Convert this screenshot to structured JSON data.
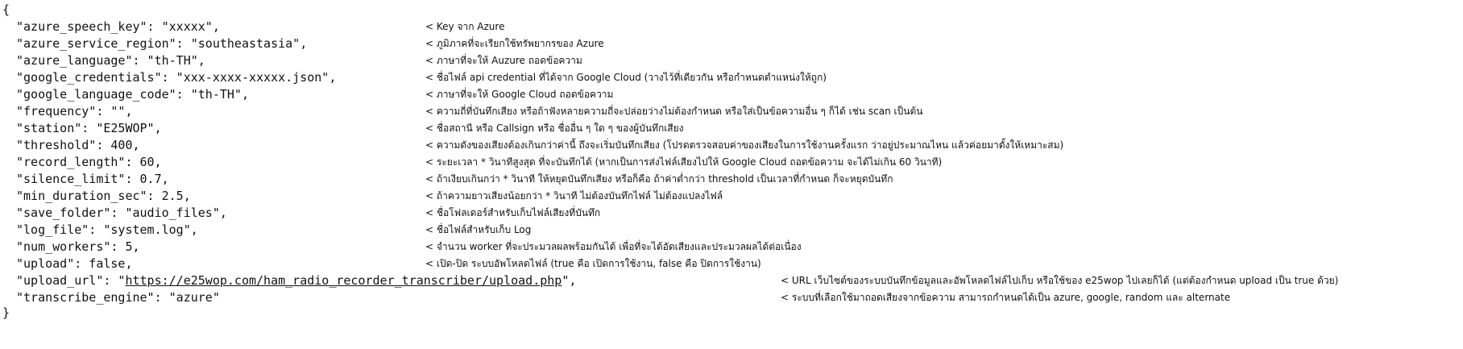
{
  "open_brace": "{",
  "close_brace": "}",
  "lines": [
    {
      "code": "\"azure_speech_key\": \"xxxxx\",",
      "note": "< Key จาก Azure"
    },
    {
      "code": "\"azure_service_region\": \"southeastasia\",",
      "note": "< ภูมิภาคที่จะเรียกใช้ทรัพยากรของ Azure"
    },
    {
      "code": "\"azure_language\": \"th-TH\",",
      "note": "< ภาษาที่จะให้ Auzure ถอดข้อความ"
    },
    {
      "code": "\"google_credentials\": \"xxx-xxxx-xxxxx.json\",",
      "note": "< ชื่อไฟล์ api credential ที่ได้จาก Google Cloud (วางไว้ที่เดียวกัน หรือกำหนดตำแหน่งให้ถูก)"
    },
    {
      "code": "\"google_language_code\": \"th-TH\",",
      "note": "< ภาษาที่จะให้ Google Cloud ถอดข้อความ"
    },
    {
      "code": "\"frequency\": \"\",",
      "note": "< ความถี่ที่บันทึกเสียง หรือถ้าฟังหลายความถี่จะปล่อยว่างไม่ต้องกำหนด หรือใส่เป็นข้อความอื่น ๆ ก็ได้ เช่น scan เป็นต้น"
    },
    {
      "code": "\"station\": \"E25WOP\",",
      "note": "< ชื่อสถานี หรือ Callsign หรือ ชื่ออื่น ๆ ใด ๆ ของผู้บันทึกเสียง"
    },
    {
      "code": "\"threshold\": 400,",
      "note": "< ความดังของเสียงต้องเกินกว่าค่านี้ ถึงจะเริ่มบันทึกเสียง (โปรดตรวจสอบค่าของเสียงในการใช้งานครั้งแรก ว่าอยู่ประมาณไหน แล้วค่อยมาตั้งให้เหมาะสม)"
    },
    {
      "code": "\"record_length\": 60,",
      "note": "< ระยะเวลา * วินาทีสูงสุด ที่จะบันทึกได้ (หากเป็นการส่งไฟล์เสียงไปให้ Google Cloud ถอดข้อความ จะได้ไม่เกิน 60 วินาที)"
    },
    {
      "code": "\"silence_limit\": 0.7,",
      "note": "< ถ้าเงียบเกินกว่า * วินาที ให้หยุดบันทึกเสียง หรือก็คือ ถ้าค่าต่ำกว่า threshold เป็นเวลาที่กำหนด ก็จะหยุดบันทึก"
    },
    {
      "code": "\"min_duration_sec\": 2.5,",
      "note": "< ถ้าความยาวเสียงน้อยกว่า * วินาที ไม่ต้องบันทึกไฟล์ ไม่ต้องแปลงไฟล์"
    },
    {
      "code": "\"save_folder\": \"audio_files\",",
      "note": "< ชื่อโฟลเดอร์สำหรับเก็บไฟล์เสียงที่บันทึก"
    },
    {
      "code": "\"log_file\": \"system.log\",",
      "note": "< ชื่อไฟล์สำหรับเก็บ Log"
    },
    {
      "code": "\"num_workers\": 5,",
      "note": "< จำนวน worker ที่จะประมวลผลพร้อมกันได้ เพื่อที่จะได้อัดเสียงและประมวลผลได้ต่อเนื่อง"
    },
    {
      "code": "\"upload\": false,",
      "note": "< เปิด-ปิด ระบบอัพโหลดไฟล์ (true คือ เปิดการใช้งาน, false คือ ปิดการใช้งาน)"
    },
    {
      "code_prefix": "\"upload_url\": \"",
      "code_link": "https://e25wop.com/ham_radio_recorder_transcriber/upload.php",
      "code_suffix": "\",",
      "note": "< URL เว็บไซต์ของระบบบันทึกข้อมูลและอัพโหลดไฟล์ไปเก็บ หรือใช้ของ e25wop ไปเลยก็ได้ (แต่ต้องกำหนด upload เป็น true ด้วย)"
    },
    {
      "code": "\"transcribe_engine\": \"azure\"",
      "note": "< ระบบที่เลือกใช้มาถอดเสียงจากข้อความ สามารถกำหนดได้เป็น azure, google, random และ alternate"
    }
  ]
}
